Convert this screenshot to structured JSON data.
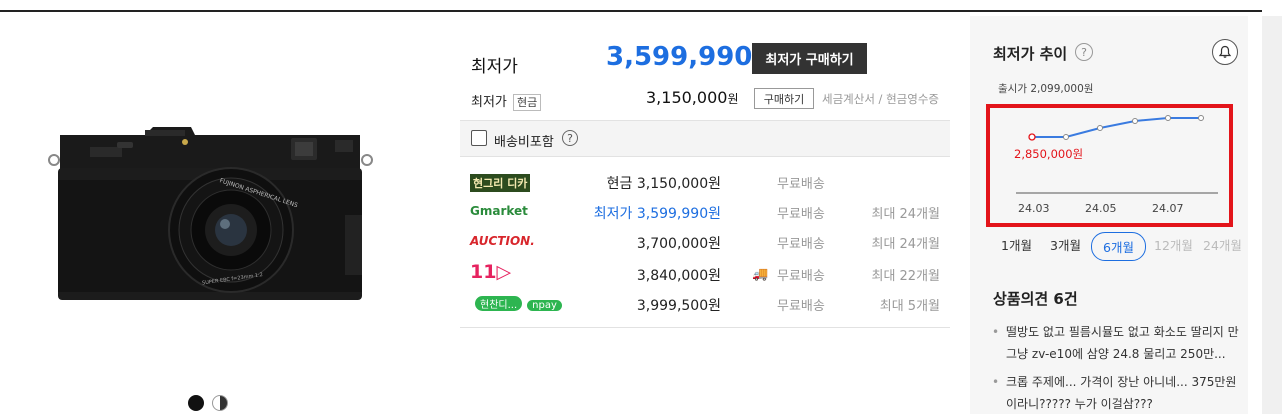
{
  "product": {
    "image_alt": "black compact camera",
    "image_dots": [
      "color-black",
      "color-black-silver"
    ],
    "lens_text": "FUJINON ASPHERICAL LENS",
    "lens_spec": "SUPER EBC f=23mm 1:2"
  },
  "price": {
    "lowest_label": "최저가",
    "lowest_value": "3,599,990",
    "won": "원",
    "buy_lowest_button": "최저가 구매하기",
    "cash_label": "최저가",
    "cash_tag": "현금",
    "cash_value": "3,150,000",
    "buy_button": "구매하기",
    "tax_note": "세금계산서 / 현금영수증"
  },
  "shipping": {
    "label": "배송비포함",
    "help": "?"
  },
  "malls": [
    {
      "logo": "현그리 디카",
      "logo_style": "hyundai",
      "price": "현금  3,150,000원",
      "highlight": false,
      "delivery": "무료배송",
      "truck": false,
      "install": ""
    },
    {
      "logo": "Gmarket",
      "logo_style": "gmarket",
      "price": "최저가 3,599,990원",
      "highlight": true,
      "delivery": "무료배송",
      "truck": false,
      "install": "최대 24개월"
    },
    {
      "logo": "AUCTION.",
      "logo_style": "auction",
      "price": "3,700,000원",
      "highlight": false,
      "delivery": "무료배송",
      "truck": false,
      "install": "최대 24개월"
    },
    {
      "logo": "11▷",
      "logo_style": "11st",
      "price": "3,840,000원",
      "highlight": false,
      "delivery": "무료배송",
      "truck": true,
      "install": "최대 22개월"
    },
    {
      "logo": "현찬디...",
      "logo_style": "npay",
      "npay": "npay",
      "price": "3,999,500원",
      "highlight": false,
      "delivery": "무료배송",
      "truck": false,
      "install": "최대 5개월"
    }
  ],
  "trend": {
    "title": "최저가 추이",
    "help": "?",
    "bell_icon": "bell-icon",
    "release_price": "출시가 2,099,000원",
    "low_label": "2,850,000원",
    "accent": "#e3141a",
    "line_color": "#3a7be0",
    "x_ticks": [
      "24.03",
      "24.05",
      "24.07"
    ],
    "periods": [
      {
        "label": "1개월",
        "state": "normal"
      },
      {
        "label": "3개월",
        "state": "normal"
      },
      {
        "label": "6개월",
        "state": "active"
      },
      {
        "label": "12개월",
        "state": "dim"
      },
      {
        "label": "24개월",
        "state": "dim"
      }
    ]
  },
  "reviews": {
    "title": "상품의견 6건",
    "items": [
      "떨방도 없고 필름시뮬도 없고 화소도 딸리지 만 그냥 zv-e10에 삼양 24.8 물리고 250만...",
      "크롭 주제에... 가격이 장난 아니네... 375만원 이라니????? 누가 이걸삼???"
    ]
  }
}
